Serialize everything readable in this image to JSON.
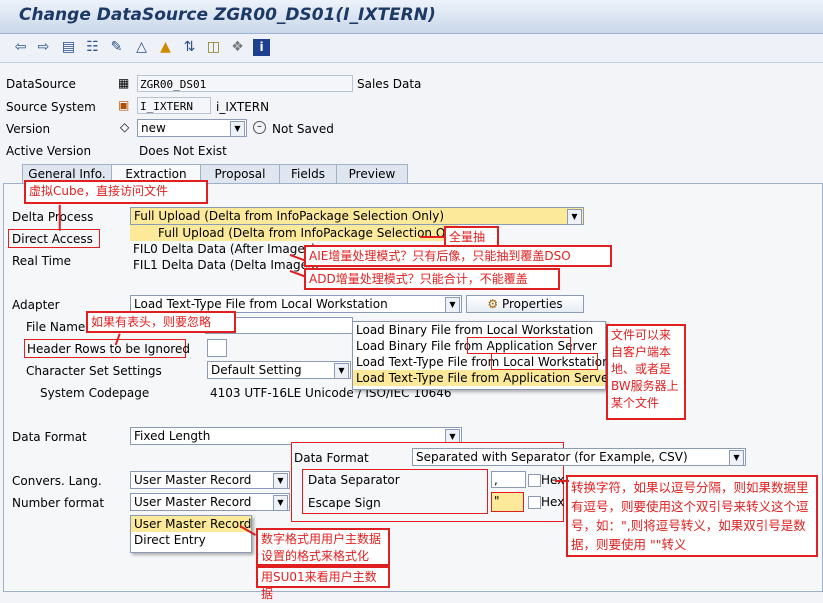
{
  "window": {
    "title": "Change DataSource ZGR00_DS01(I_IXTERN)"
  },
  "toolbar": {
    "icons": [
      "back-arrow-icon",
      "forward-arrow-icon",
      "display-icon",
      "hierarchy-icon",
      "edit-pencil-icon",
      "where-used-icon",
      "info-pin-icon",
      "sort-icon",
      "database-icon",
      "object-icon",
      "information-icon"
    ]
  },
  "header": {
    "datasource_label": "DataSource",
    "datasource_value": "ZGR00_DS01",
    "datasource_text": "Sales Data",
    "source_system_label": "Source System",
    "source_system_value": "I_IXTERN",
    "source_system_text": "i_IXTERN",
    "version_label": "Version",
    "version_value": "new",
    "version_status": "Not Saved",
    "active_version_label": "Active Version",
    "active_version_value": "Does Not Exist"
  },
  "tabs": [
    "General Info.",
    "Extraction",
    "Proposal",
    "Fields",
    "Preview"
  ],
  "extraction": {
    "delta_process_label": "Delta Process",
    "delta_process_value": "Full Upload (Delta from InfoPackage Selection Only)",
    "delta_options": [
      {
        "label": "Full Upload (Delta from InfoPackage Selection Only)"
      },
      {
        "label": "FIL0 Delta Data (After Images)"
      },
      {
        "label": "FIL1 Delta Data (Delta Images)"
      }
    ],
    "direct_access_label": "Direct Access",
    "real_time_label": "Real Time",
    "adapter_label": "Adapter",
    "adapter_value": "Load Text-Type File from Local Workstation",
    "properties_label": "Properties",
    "adapter_options": [
      {
        "label": "Load Binary File from Local Workstation"
      },
      {
        "label": "Load Binary File from Application Server"
      },
      {
        "label": "Load Text-Type File from Local Workstation"
      },
      {
        "label": "Load Text-Type File from Application Server"
      }
    ],
    "file_name_label": "File Name",
    "header_rows_label": "Header Rows to be Ignored",
    "charset_label": "Character Set Settings",
    "charset_value": "Default Setting",
    "codepage_label": "System Codepage",
    "codepage_value": "4103  UTF-16LE Unicode / ISO/IEC 10646",
    "data_format_label": "Data Format",
    "data_format_value": "Fixed Length",
    "popup_data_format_label": "Data Format",
    "popup_data_format_value": "Separated with Separator (for Example, CSV)",
    "data_separator_label": "Data Separator",
    "data_separator_value": ",",
    "escape_sign_label": "Escape Sign",
    "escape_sign_value": "\"",
    "hex_label": "Hex",
    "convers_lang_label": "Convers. Lang.",
    "convers_lang_value": "User Master Record",
    "number_format_label": "Number format",
    "number_format_value": "User Master Record",
    "number_format_options": [
      {
        "label": "User Master Record"
      },
      {
        "label": "Direct Entry"
      }
    ]
  },
  "annotations": {
    "virtual_cube": "虚拟Cube，直接访问文件",
    "full_extract": "全量抽",
    "aie_mode": "AIE增量处理模式？只有后像，只能抽到覆盖DSO",
    "add_mode": "ADD增量处理模式？只能合计，不能覆盖",
    "header_rows": "如果有表头，则要忽略",
    "file_source": "文件可以来自客户端本地、或者是BW服务器上某个文件",
    "escape": "转换字符，如果以逗号分隔，则如果数据里有逗号，则要使用这个双引号来转义这个逗号，如：\",则将逗号转义，如果双引号是数据，则要使用 \"\"转义",
    "number_format": "数字格式用用户主数据设置的格式来格式化",
    "su01": "用SU01来看用户主数据"
  }
}
